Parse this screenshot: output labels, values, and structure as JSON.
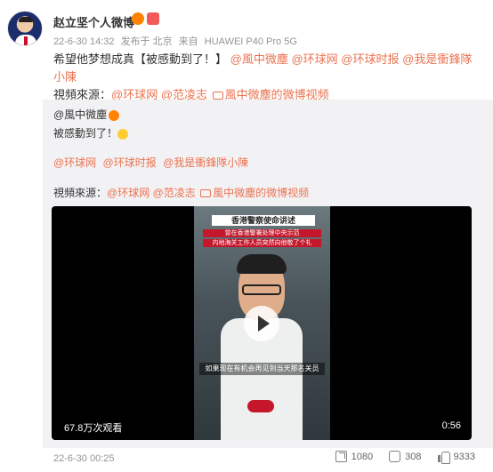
{
  "post": {
    "username": "赵立坚个人微博",
    "meta": {
      "time": "22-6-30 14:32",
      "source_prefix": "发布于 北京",
      "device_prefix": "来自",
      "device": "HUAWEI P40 Pro 5G"
    },
    "content": {
      "text": "希望他梦想成真【被感動到了！】",
      "mentions": [
        "@風中微塵",
        "@环球网",
        "@环球时报",
        "@我是衝鋒隊小陳"
      ],
      "source_label": "視頻來源：",
      "source_mentions": [
        "@环球网",
        "@范凌志"
      ],
      "video_link": "風中微塵的微博视频"
    }
  },
  "repost": {
    "author": "@風中微塵",
    "text": "被感動到了！",
    "mentions": [
      "@环球网",
      "@环球时报",
      "@我是衝鋒隊小陳"
    ],
    "source_label": "視頻來源：",
    "source_mentions": [
      "@环球网",
      "@范凌志"
    ],
    "video_link": "風中微塵的微博视频",
    "video": {
      "frame_title": "香港警察使命讲述",
      "banner1": "曾在香港警署处理中央示范",
      "banner2": "内地海关工作人员突然向他敬了个礼",
      "caption": "如果现在有机会再见到当天那名关员",
      "views": "67.8万次观看",
      "duration": "0:56"
    }
  },
  "footer": {
    "time": "22-6-30 00:25",
    "share_count": "1080",
    "comment_count": "308",
    "like_count": "9333"
  },
  "colors": {
    "link": "#eb7350",
    "meta": "#939393",
    "repost_bg": "#f2f2f5"
  },
  "icons": [
    "share-icon",
    "comment-icon",
    "like-icon",
    "play-icon",
    "video-link-icon"
  ]
}
